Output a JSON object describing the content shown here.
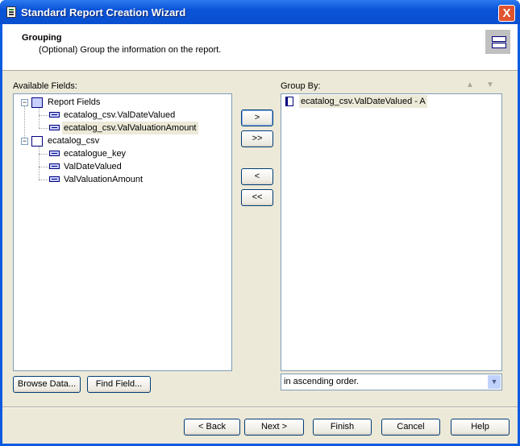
{
  "window": {
    "title": "Standard Report Creation Wizard",
    "close_label": "X"
  },
  "header": {
    "title": "Grouping",
    "subtitle": "(Optional) Group the information on the report."
  },
  "available": {
    "label": "Available Fields:",
    "tree": [
      {
        "label": "Report Fields",
        "children": [
          "ecatalog_csv.ValDateValued",
          "ecatalog_csv.ValValuationAmount"
        ]
      },
      {
        "label": "ecatalog_csv",
        "children": [
          "ecatalogue_key",
          "ValDateValued",
          "ValValuationAmount"
        ]
      }
    ],
    "selected": "ecatalog_csv.ValValuationAmount"
  },
  "transfer": {
    "add": ">",
    "add_all": ">>",
    "remove": "<",
    "remove_all": "<<"
  },
  "group_by": {
    "label": "Group By:",
    "items": [
      "ecatalog_csv.ValDateValued - A"
    ],
    "up_icon": "arrow-up-icon",
    "down_icon": "arrow-down-icon",
    "order": "in ascending order."
  },
  "buttons": {
    "browse": "Browse Data...",
    "find": "Find Field...",
    "back": "< Back",
    "next": "Next >",
    "finish": "Finish",
    "cancel": "Cancel",
    "help": "Help"
  }
}
